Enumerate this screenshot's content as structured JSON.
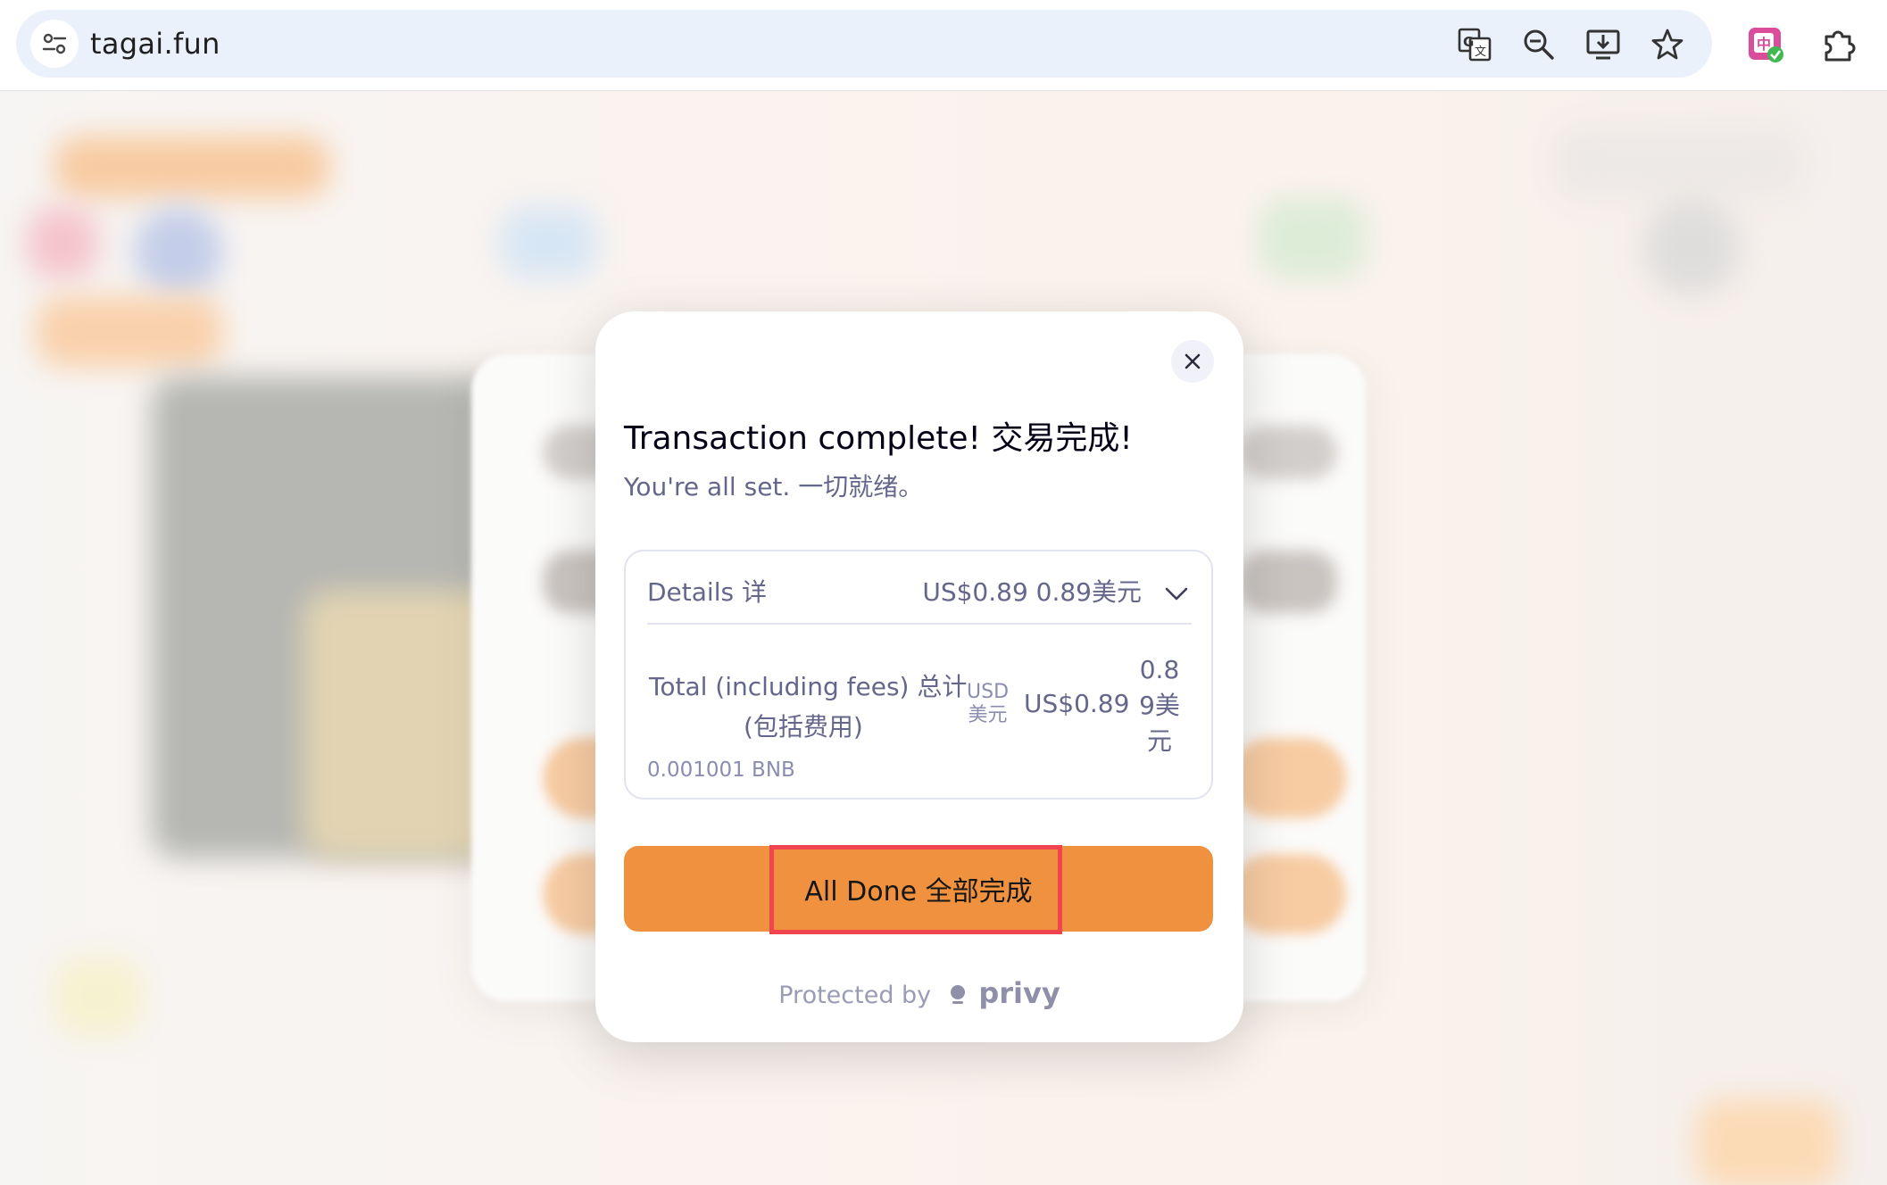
{
  "browser": {
    "url": "tagai.fun",
    "icons": [
      "site-info-icon",
      "translate-icon",
      "zoom-icon",
      "install-app-icon",
      "bookmark-star-icon",
      "extension-translate-icon",
      "extensions-puzzle-icon"
    ]
  },
  "modal": {
    "title": "Transaction complete!  交易完成!",
    "subtitle": "You're all set.  一切就绪。",
    "details": {
      "label": "Details  详",
      "value": "US$0.89   0.89美元",
      "total_label_line1": "Total (including fees)  总计",
      "total_label_line2": "(包括费用)",
      "usd_tag_line1": "USD",
      "usd_tag_line2": "美元",
      "total_value": "US$0.89",
      "total_value_cn_1": "0.8",
      "total_value_cn_2": "9美",
      "total_value_cn_3": "元",
      "bnb_amount": "0.001001 BNB"
    },
    "done_button": "All Done  全部完成",
    "protected_by": "Protected by",
    "privy": "privy"
  },
  "colors": {
    "accent": "#ef913e",
    "highlight_box": "#f0454f",
    "muted_text": "#64668b"
  }
}
